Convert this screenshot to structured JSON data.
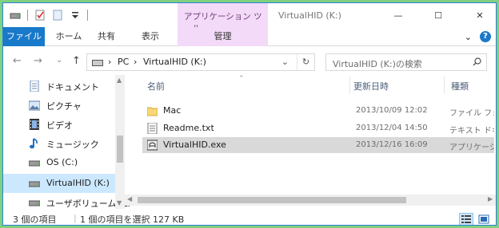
{
  "title_bar": {
    "context_tab_header": "アプリケーション ツール",
    "window_title": "VirtualHID (K:)",
    "minimize": "—",
    "maximize": "☐",
    "close": "✕"
  },
  "ribbon": {
    "tabs": [
      "ファイル",
      "ホーム",
      "共有",
      "表示",
      "管理"
    ],
    "expand": "⌄",
    "help": "?"
  },
  "address": {
    "crumbs": [
      "PC",
      "VirtualHID (K:)"
    ],
    "separator": "›",
    "dropdown": "⌄",
    "refresh": "↻",
    "search_placeholder": "VirtualHID (K:)の検索"
  },
  "nav_buttons": {
    "back": "←",
    "forward": "→",
    "recent": "⌄",
    "up": "↑"
  },
  "nav_pane": {
    "items": [
      "ドキュメント",
      "ピクチャ",
      "ビデオ",
      "ミュージック",
      "OS (C:)",
      "VirtualHID (K:)",
      "ユーザボリューム (L:"
    ],
    "selected_index": 5
  },
  "columns": {
    "name": "名前",
    "date": "更新日時",
    "type": "種類"
  },
  "files": [
    {
      "name": "Mac",
      "date": "2013/10/09 12:02",
      "type": "ファイル フォルダー",
      "icon": "folder-icon"
    },
    {
      "name": "Readme.txt",
      "date": "2013/12/04 14:50",
      "type": "テキスト ドキュメント",
      "icon": "text-file-icon"
    },
    {
      "name": "VirtualHID.exe",
      "date": "2013/12/16 16:09",
      "type": "アプリケーション",
      "icon": "exe-icon"
    }
  ],
  "selected_file_index": 2,
  "status": {
    "count": "3 個の項目",
    "selection": "1 個の項目を選択  127 KB"
  },
  "colors": {
    "accent": "#1979ca",
    "context_tab": "#f3daf8",
    "selection": "#cce8ff",
    "row_selected": "#d9d9d9",
    "background": "#7fd07f"
  }
}
